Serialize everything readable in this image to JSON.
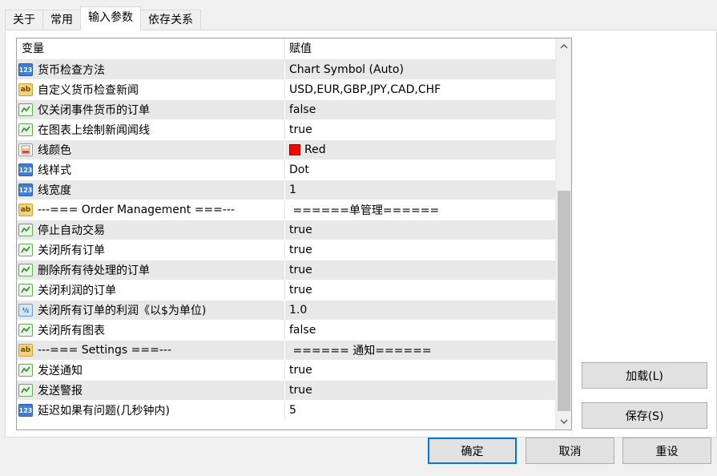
{
  "tabs": [
    {
      "label": "关于",
      "active": false
    },
    {
      "label": "常用",
      "active": false
    },
    {
      "label": "输入参数",
      "active": true
    },
    {
      "label": "依存关系",
      "active": false
    }
  ],
  "grid": {
    "header": {
      "variable": "变量",
      "value": "赋值"
    },
    "rows": [
      {
        "icon": "int",
        "variable": "货币检查方法",
        "value": "Chart Symbol (Auto)"
      },
      {
        "icon": "string",
        "variable": "自定义货币检查新闻",
        "value": "USD,EUR,GBP,JPY,CAD,CHF"
      },
      {
        "icon": "bool",
        "variable": "仅关闭事件货币的订单",
        "value": "false"
      },
      {
        "icon": "bool",
        "variable": "在图表上绘制新闻闻线",
        "value": "true"
      },
      {
        "icon": "color",
        "variable": "线颜色",
        "value": "Red",
        "swatch": "#ff0000"
      },
      {
        "icon": "int",
        "variable": "线样式",
        "value": "Dot"
      },
      {
        "icon": "int",
        "variable": "线宽度",
        "value": "1"
      },
      {
        "icon": "string",
        "variable": "---=== Order Management ===---",
        "value": " ======单管理======"
      },
      {
        "icon": "bool",
        "variable": "停止自动交易",
        "value": "true"
      },
      {
        "icon": "bool",
        "variable": "关闭所有订单",
        "value": "true"
      },
      {
        "icon": "bool",
        "variable": "删除所有待处理的订单",
        "value": "true"
      },
      {
        "icon": "bool",
        "variable": "关闭利润的订单",
        "value": "true"
      },
      {
        "icon": "double",
        "variable": "关闭所有订单的利润《以$为单位)",
        "value": "1.0"
      },
      {
        "icon": "bool",
        "variable": "关闭所有图表",
        "value": "false"
      },
      {
        "icon": "string",
        "variable": "---=== Settings ===---",
        "value": " ====== 通知======"
      },
      {
        "icon": "bool",
        "variable": "发送通知",
        "value": "true"
      },
      {
        "icon": "bool",
        "variable": "发送警报",
        "value": "true"
      },
      {
        "icon": "int",
        "variable": "延迟如果有问题(几秒钟内)",
        "value": "5"
      }
    ]
  },
  "icon_glyphs": {
    "int": "123",
    "string": "ab",
    "double": "½",
    "bool": "check-icon",
    "color": "palette-icon"
  },
  "side_buttons": {
    "load": "加载(L)",
    "save": "保存(S)"
  },
  "footer_buttons": {
    "ok": "确定",
    "cancel": "取消",
    "reset": "重设"
  }
}
